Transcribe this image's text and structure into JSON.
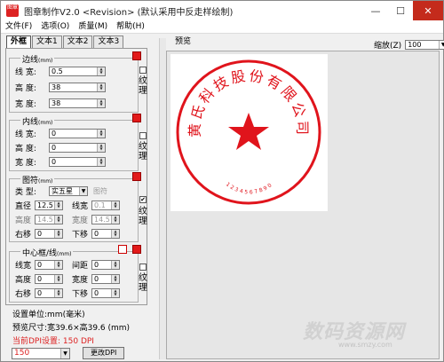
{
  "window": {
    "title": "图章制作V2.0 <Revision> (默认采用中反走样绘制)",
    "icon_text": "图章",
    "minimize": "—",
    "maximize": "☐",
    "close": "✕"
  },
  "menu": [
    "文件(F)",
    "选项(O)",
    "质量(M)",
    "帮助(H)"
  ],
  "tabs": [
    "外框",
    "文本1",
    "文本2",
    "文本3"
  ],
  "groups": {
    "border": {
      "title": "边线",
      "unit": "(mm)",
      "rows": [
        {
          "label": "线  宽:",
          "value": "0.5"
        },
        {
          "label": "高  度:",
          "value": "38"
        },
        {
          "label": "宽  度:",
          "value": "38"
        }
      ],
      "texture": "纹理"
    },
    "inner": {
      "title": "内线",
      "unit": "(mm)",
      "rows": [
        {
          "label": "线  宽:",
          "value": "0"
        },
        {
          "label": "高  度:",
          "value": "0"
        },
        {
          "label": "宽  度:",
          "value": "0"
        }
      ],
      "texture": "纹理"
    },
    "shape": {
      "title": "图符",
      "unit": "(mm)",
      "type_label": "类  型:",
      "type_value": "实五星",
      "shape_btn": "图符",
      "diameter_label": "直径",
      "diameter_value": "12.5",
      "linewidth_label": "线宽",
      "linewidth_value": "0.1",
      "height_label": "高度",
      "height_value": "14.5",
      "width_label": "宽度",
      "width_value": "14.5",
      "right_label": "右移",
      "right_value": "0",
      "down_label": "下移",
      "down_value": "0",
      "texture": "纹理",
      "checked": "✔"
    },
    "center": {
      "title": "中心框/线",
      "unit": "(mm)",
      "linewidth_label": "线宽",
      "linewidth_value": "0",
      "gap_label": "间距",
      "gap_value": "0",
      "height_label": "高度",
      "height_value": "0",
      "width_label": "宽度",
      "width_value": "0",
      "right_label": "右移",
      "right_value": "0",
      "down_label": "下移",
      "down_value": "0",
      "texture": "纹理"
    }
  },
  "info": {
    "unit_text": "设置单位:mm(毫米)",
    "size_text": "预览尺寸:宽39.6×高39.6 (mm)",
    "dpi_text": "当前DPI设置: 150 DPI",
    "dpi_value": "150",
    "change_dpi": "更改DPI"
  },
  "preview": {
    "label": "预览",
    "zoom_label": "缩放(Z)",
    "zoom_value": "100",
    "seal_text": "黄氏科技股份有限公司",
    "seal_number": "1234567890",
    "seal_color": "#e0141c"
  },
  "watermark": {
    "text": "数码资源网",
    "sub": "www.smzy.com"
  }
}
